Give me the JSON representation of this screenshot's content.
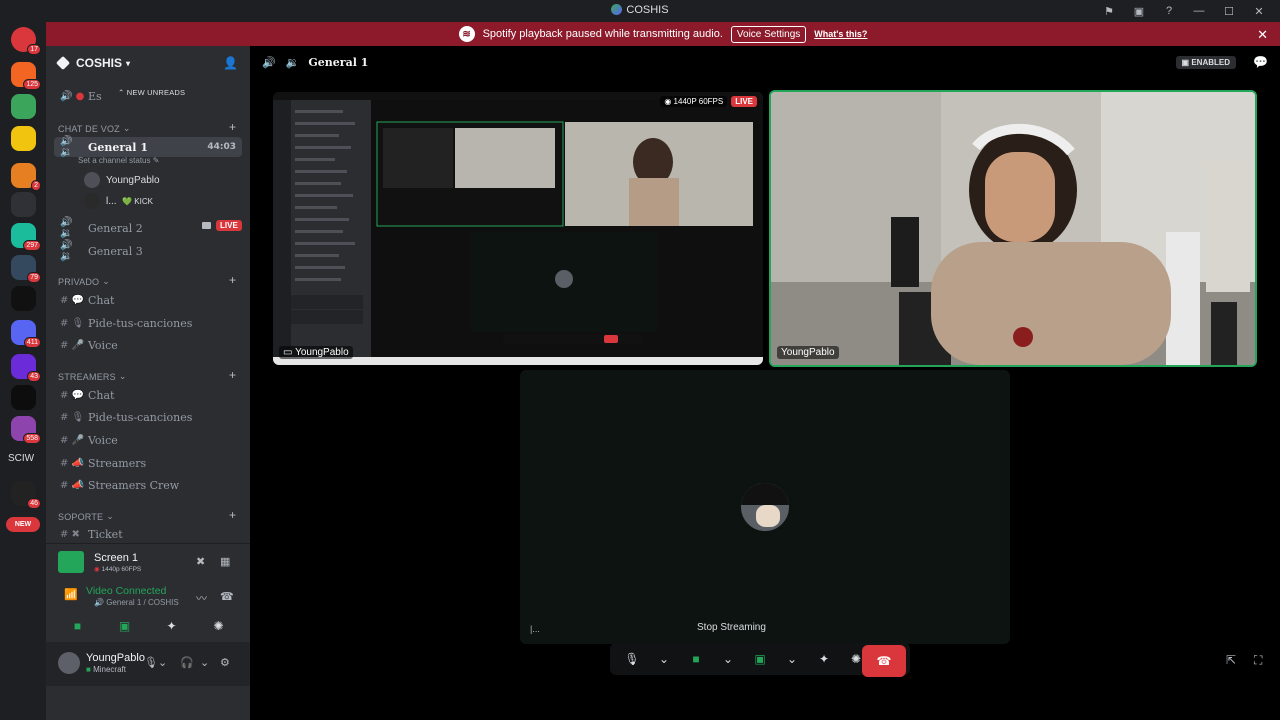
{
  "window": {
    "title": "COSHIS"
  },
  "notice": {
    "text": "Spotify playback paused while transmitting audio.",
    "voice_settings": "Voice Settings",
    "whats_this": "What's this?"
  },
  "rail": {
    "badges": [
      "17",
      "125",
      "2",
      "297",
      "79",
      "411",
      "43",
      "558",
      "46"
    ],
    "text_server": "SCIW",
    "new_label": "NEW"
  },
  "sidebar": {
    "server_name": "COSHIS",
    "new_unreads": "NEW UNREADS",
    "partial_channel": "Es",
    "categories": {
      "voz": "CHAT DE VOZ",
      "privado": "PRIVADO",
      "streamers": "STREAMERS",
      "soporte": "SOPORTE"
    },
    "voice_channels": [
      {
        "name": "General 1",
        "timer": "44:03"
      },
      {
        "name": "General 2"
      },
      {
        "name": "General 3"
      }
    ],
    "channel_status": "Set a channel status",
    "members": [
      {
        "name": "YoungPablo",
        "tag": "LIVE"
      },
      {
        "name": "l...",
        "extra": "💚 KICK"
      }
    ],
    "privado_channels": [
      "Chat",
      "Pide-tus-canciones",
      "Voice"
    ],
    "streamers_channels": [
      "Chat",
      "Pide-tus-canciones",
      "Voice",
      "Streamers",
      "Streamers Crew"
    ],
    "soporte_channels": [
      "Ticket"
    ]
  },
  "screen_share": {
    "title": "Screen 1",
    "quality": "1440p 60FPS"
  },
  "voice": {
    "status": "Video Connected",
    "location": "General 1 / COSHIS"
  },
  "user": {
    "name": "YoungPablo",
    "activity": "Minecraft"
  },
  "main": {
    "channel": "General 1",
    "enabled": "ENABLED",
    "stream_tile": {
      "user": "YoungPablo",
      "quality": "1440P 60FPS",
      "live": "LIVE"
    },
    "cam_tile": {
      "user": "YoungPablo"
    },
    "you_tile": {
      "corner": "|..."
    },
    "stop_streaming": "Stop Streaming"
  },
  "colors": {
    "accent_green": "#23a55a",
    "danger_red": "#da373c",
    "notice_bg": "#8c1a2b"
  }
}
